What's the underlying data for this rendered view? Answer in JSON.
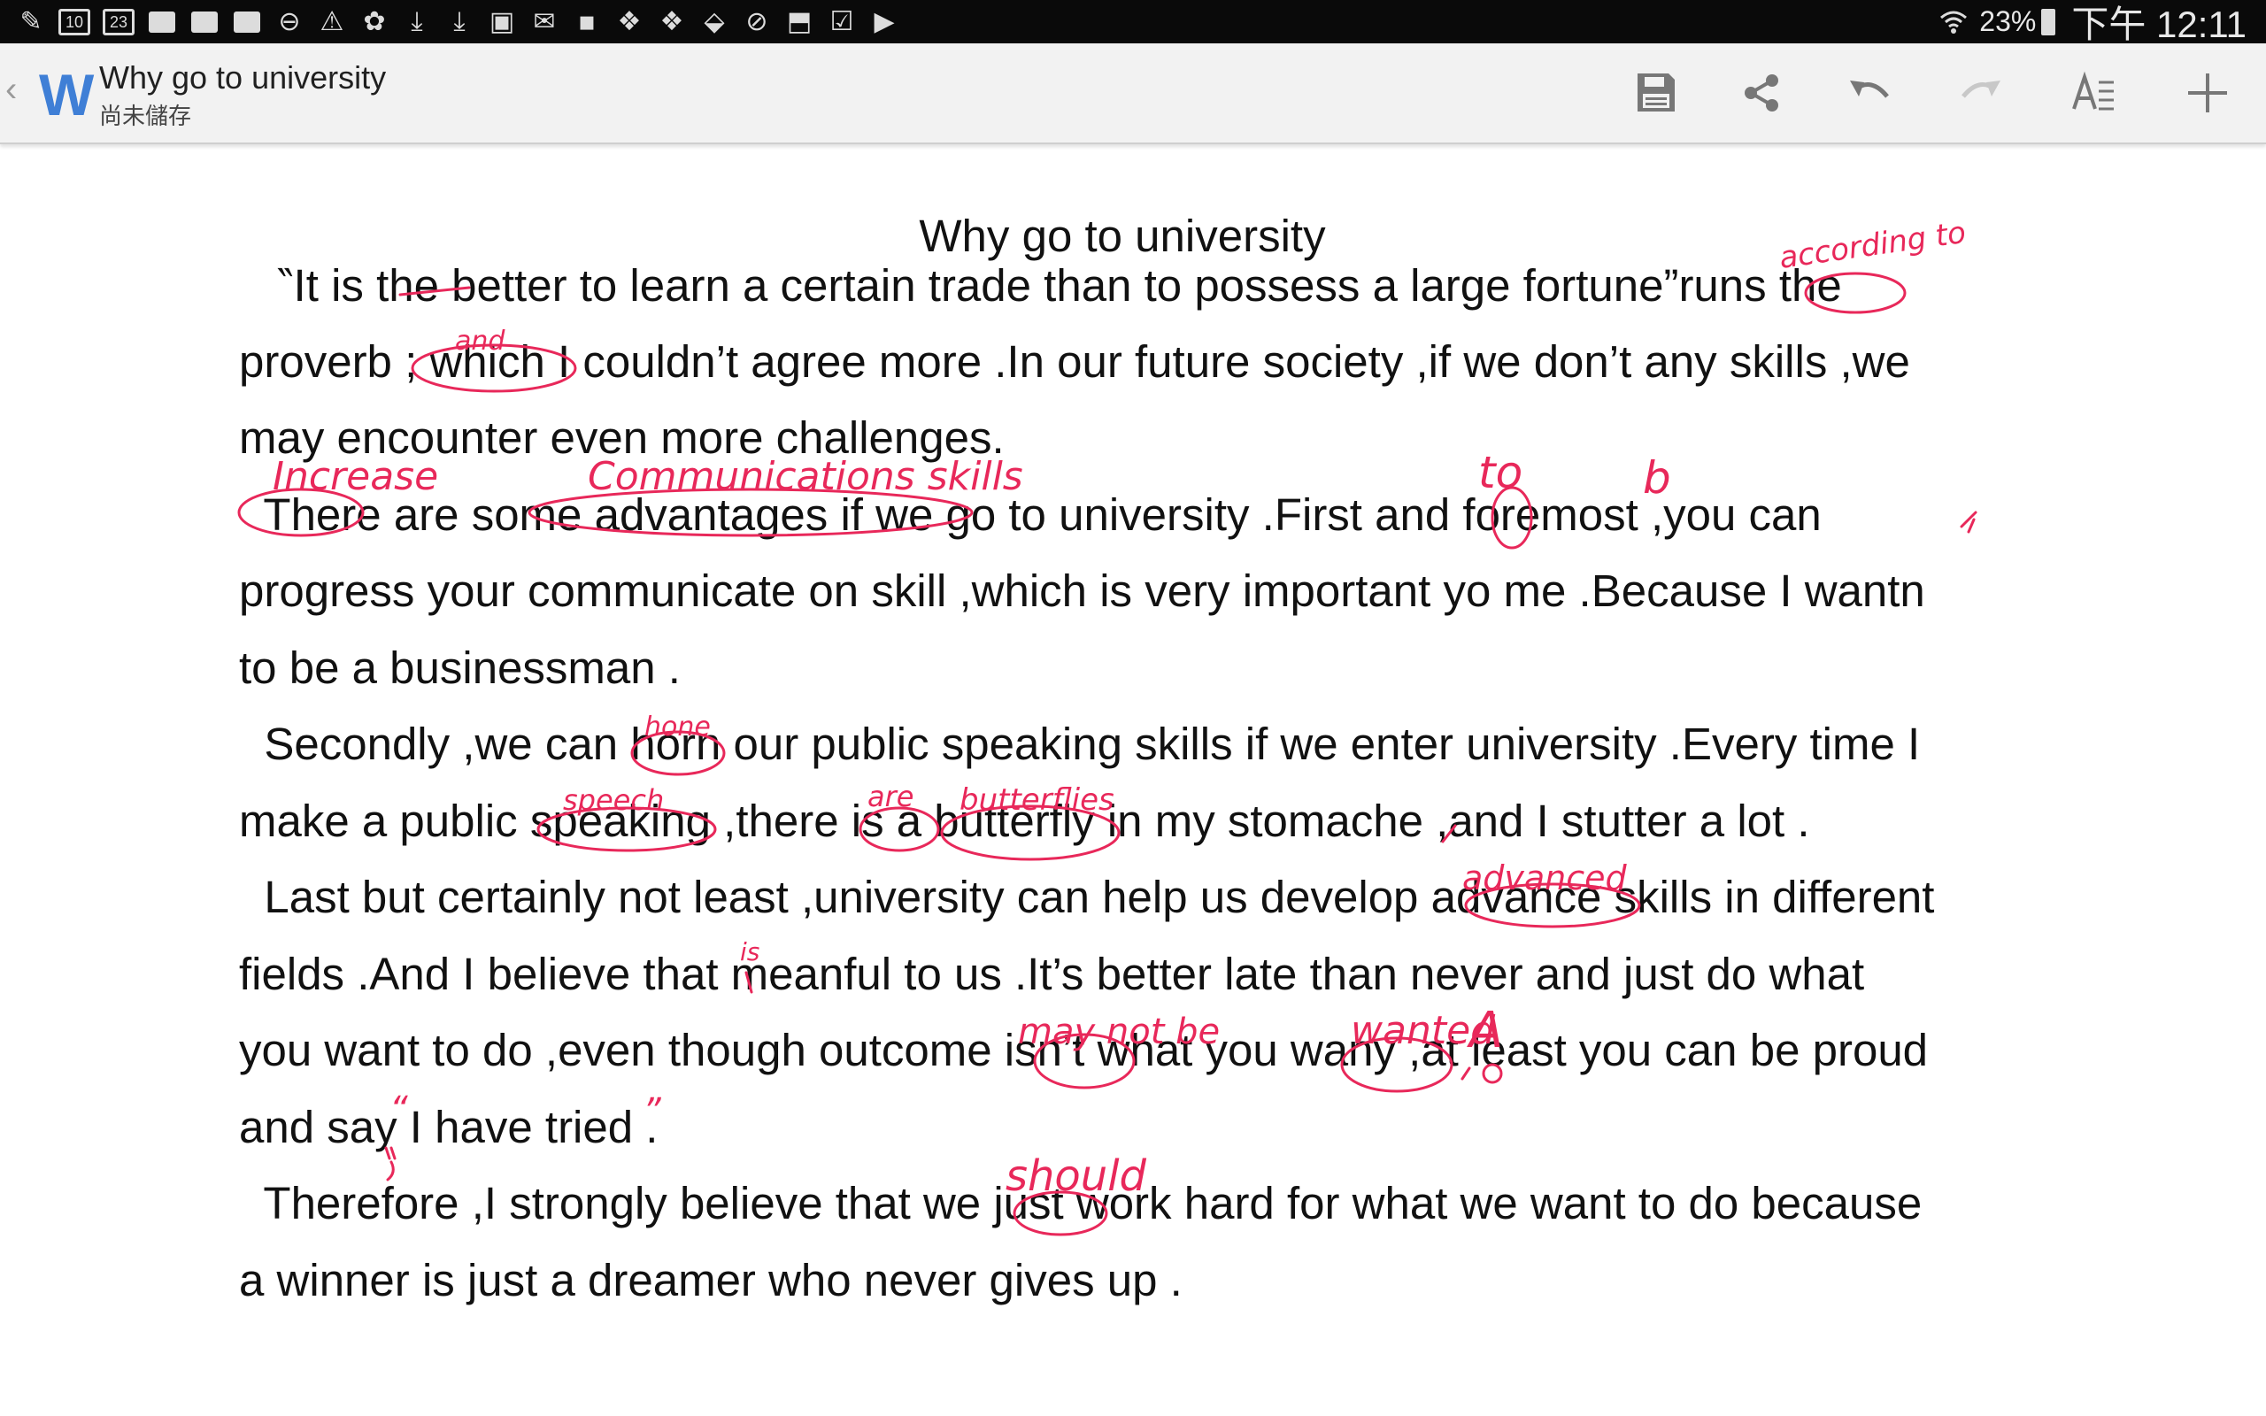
{
  "status_bar": {
    "notification_icons": [
      "app-icon",
      "calendar-icon",
      "calendar-icon",
      "chat-icon",
      "chat-icon",
      "chat-icon",
      "do-not-disturb-icon",
      "warning-icon",
      "evernote-icon",
      "download-icon",
      "download-icon",
      "image-icon",
      "mail-icon",
      "voicemail-icon",
      "apps-icon",
      "apps-icon",
      "download-icon",
      "compass-icon",
      "upload-icon",
      "checklist-icon",
      "play-icon"
    ],
    "calendar_day": "10",
    "calendar_day_2": "23",
    "battery": "23%",
    "time": "下午 12:11"
  },
  "app_bar": {
    "logo": "W",
    "title": "Why go to university",
    "status": "尚未儲存",
    "toolbar": [
      "save-icon",
      "share-icon",
      "undo-icon",
      "redo-icon",
      "text-format-icon",
      "add-icon"
    ]
  },
  "document": {
    "heading": "Why go to university",
    "lines": [
      "   ‶It is the better to learn a certain trade than to possess a large fortune”runs the",
      "proverb ; which I couldn’t agree more .In our future society ,if we don’t any skills ,we",
      "may encounter even more challenges.",
      "  There are some advantages if we go to university .First and foremost ,you can",
      "progress your communicate on skill ,which is very important yo me .Because I wantn",
      "to be a businessman .",
      "  Secondly ,we can horn our public speaking skills if we enter university .Every time I",
      "make a public speaking ,there is a butterfly in my stomache ,and I stutter a lot .",
      "  Last but certainly not least ,university can help us develop advance skills in different",
      "fields .And I believe that meanful to us .It’s better late than never and just do what",
      "you want to do ,even though outcome isn’t what you wany ,at least you can be proud",
      "and say I have tried .",
      "  Therefore ,I strongly believe that we just work hard for what we want to do because",
      "a winner is just a dreamer who never gives up ."
    ]
  },
  "annotations": {
    "according_to": "according to",
    "and": "and",
    "increase": "Increase",
    "communications_skills": "Communications skills",
    "to": "to",
    "b": "b",
    "hone": "hone",
    "speech": "speech",
    "are": "are",
    "butterflies": "butterflies",
    "advanced": "advanced",
    "is": "is",
    "may_not_be": "may not be",
    "wanted": "wanted",
    "a": "A",
    "open_quote": "“",
    "close_quote": "”",
    "should": "should"
  },
  "colors": {
    "ink": "#e8285a",
    "logo": "#3f7fd6",
    "toolbar_icon": "#777777",
    "toolbar_icon_disabled": "#c8c8c8"
  }
}
